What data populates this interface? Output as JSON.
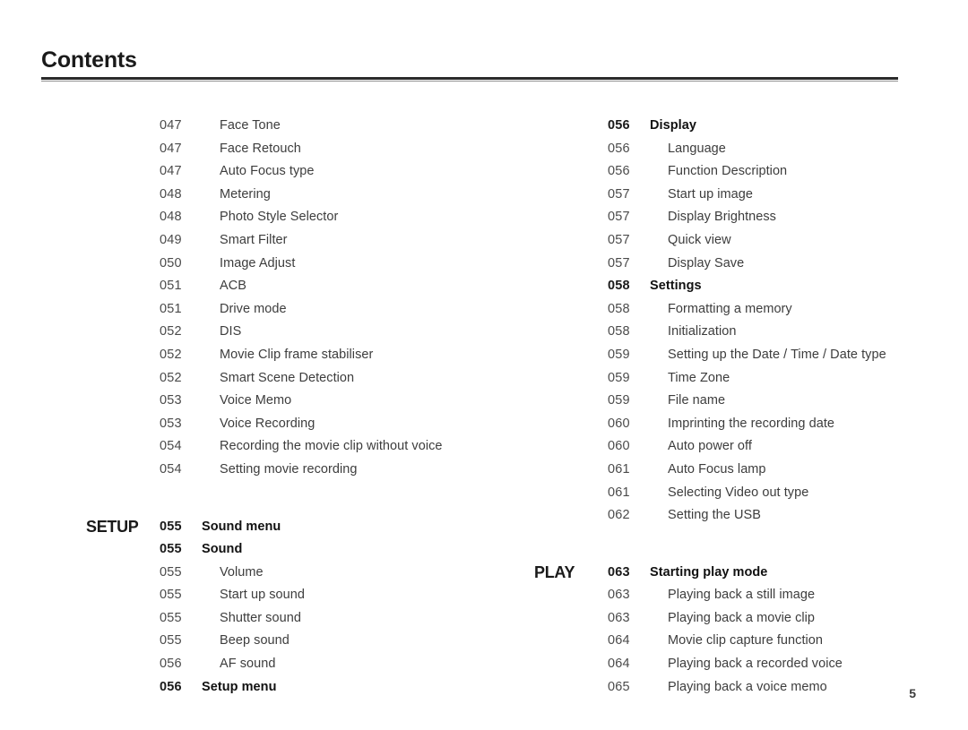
{
  "header": {
    "title": "Contents"
  },
  "page_number": "5",
  "left_column": [
    {
      "section": "",
      "num": "047",
      "label": "Face Tone",
      "bold": false,
      "gap_before": false
    },
    {
      "section": "",
      "num": "047",
      "label": "Face Retouch",
      "bold": false,
      "gap_before": false
    },
    {
      "section": "",
      "num": "047",
      "label": "Auto Focus type",
      "bold": false,
      "gap_before": false
    },
    {
      "section": "",
      "num": "048",
      "label": "Metering",
      "bold": false,
      "gap_before": false
    },
    {
      "section": "",
      "num": "048",
      "label": "Photo Style Selector",
      "bold": false,
      "gap_before": false
    },
    {
      "section": "",
      "num": "049",
      "label": "Smart Filter",
      "bold": false,
      "gap_before": false
    },
    {
      "section": "",
      "num": "050",
      "label": "Image Adjust",
      "bold": false,
      "gap_before": false
    },
    {
      "section": "",
      "num": "051",
      "label": "ACB",
      "bold": false,
      "gap_before": false
    },
    {
      "section": "",
      "num": "051",
      "label": "Drive mode",
      "bold": false,
      "gap_before": false
    },
    {
      "section": "",
      "num": "052",
      "label": "DIS",
      "bold": false,
      "gap_before": false
    },
    {
      "section": "",
      "num": "052",
      "label": "Movie Clip frame stabiliser",
      "bold": false,
      "gap_before": false
    },
    {
      "section": "",
      "num": "052",
      "label": "Smart Scene Detection",
      "bold": false,
      "gap_before": false
    },
    {
      "section": "",
      "num": "053",
      "label": "Voice Memo",
      "bold": false,
      "gap_before": false
    },
    {
      "section": "",
      "num": "053",
      "label": "Voice Recording",
      "bold": false,
      "gap_before": false
    },
    {
      "section": "",
      "num": "054",
      "label": "Recording the movie clip without voice",
      "bold": false,
      "gap_before": false
    },
    {
      "section": "",
      "num": "054",
      "label": "Setting movie recording",
      "bold": false,
      "gap_before": false
    },
    {
      "section": "SETUP",
      "num": "055",
      "label": "Sound menu",
      "bold": true,
      "gap_before": true
    },
    {
      "section": "",
      "num": "055",
      "label": "Sound",
      "bold": true,
      "gap_before": false
    },
    {
      "section": "",
      "num": "055",
      "label": "Volume",
      "bold": false,
      "gap_before": false
    },
    {
      "section": "",
      "num": "055",
      "label": "Start up sound",
      "bold": false,
      "gap_before": false
    },
    {
      "section": "",
      "num": "055",
      "label": "Shutter sound",
      "bold": false,
      "gap_before": false
    },
    {
      "section": "",
      "num": "055",
      "label": "Beep sound",
      "bold": false,
      "gap_before": false
    },
    {
      "section": "",
      "num": "056",
      "label": "AF sound",
      "bold": false,
      "gap_before": false
    },
    {
      "section": "",
      "num": "056",
      "label": "Setup menu",
      "bold": true,
      "gap_before": false
    }
  ],
  "right_column": [
    {
      "section": "",
      "num": "056",
      "label": "Display",
      "bold": true,
      "gap_before": false
    },
    {
      "section": "",
      "num": "056",
      "label": "Language",
      "bold": false,
      "gap_before": false
    },
    {
      "section": "",
      "num": "056",
      "label": "Function Description",
      "bold": false,
      "gap_before": false
    },
    {
      "section": "",
      "num": "057",
      "label": "Start up image",
      "bold": false,
      "gap_before": false
    },
    {
      "section": "",
      "num": "057",
      "label": "Display Brightness",
      "bold": false,
      "gap_before": false
    },
    {
      "section": "",
      "num": "057",
      "label": "Quick view",
      "bold": false,
      "gap_before": false
    },
    {
      "section": "",
      "num": "057",
      "label": "Display Save",
      "bold": false,
      "gap_before": false
    },
    {
      "section": "",
      "num": "058",
      "label": "Settings",
      "bold": true,
      "gap_before": false
    },
    {
      "section": "",
      "num": "058",
      "label": "Formatting a memory",
      "bold": false,
      "gap_before": false
    },
    {
      "section": "",
      "num": "058",
      "label": "Initialization",
      "bold": false,
      "gap_before": false
    },
    {
      "section": "",
      "num": "059",
      "label": "Setting up the Date / Time / Date type",
      "bold": false,
      "gap_before": false
    },
    {
      "section": "",
      "num": "059",
      "label": "Time Zone",
      "bold": false,
      "gap_before": false
    },
    {
      "section": "",
      "num": "059",
      "label": "File name",
      "bold": false,
      "gap_before": false
    },
    {
      "section": "",
      "num": "060",
      "label": "Imprinting the recording date",
      "bold": false,
      "gap_before": false
    },
    {
      "section": "",
      "num": "060",
      "label": "Auto power off",
      "bold": false,
      "gap_before": false
    },
    {
      "section": "",
      "num": "061",
      "label": "Auto Focus lamp",
      "bold": false,
      "gap_before": false
    },
    {
      "section": "",
      "num": "061",
      "label": "Selecting Video out type",
      "bold": false,
      "gap_before": false
    },
    {
      "section": "",
      "num": "062",
      "label": "Setting the USB",
      "bold": false,
      "gap_before": false
    },
    {
      "section": "PLAY",
      "num": "063",
      "label": "Starting play mode",
      "bold": true,
      "gap_before": true
    },
    {
      "section": "",
      "num": "063",
      "label": "Playing back a still image",
      "bold": false,
      "gap_before": false
    },
    {
      "section": "",
      "num": "063",
      "label": "Playing back a movie clip",
      "bold": false,
      "gap_before": false
    },
    {
      "section": "",
      "num": "064",
      "label": "Movie clip capture function",
      "bold": false,
      "gap_before": false
    },
    {
      "section": "",
      "num": "064",
      "label": "Playing back a recorded voice",
      "bold": false,
      "gap_before": false
    },
    {
      "section": "",
      "num": "065",
      "label": "Playing back a voice memo",
      "bold": false,
      "gap_before": false
    }
  ]
}
